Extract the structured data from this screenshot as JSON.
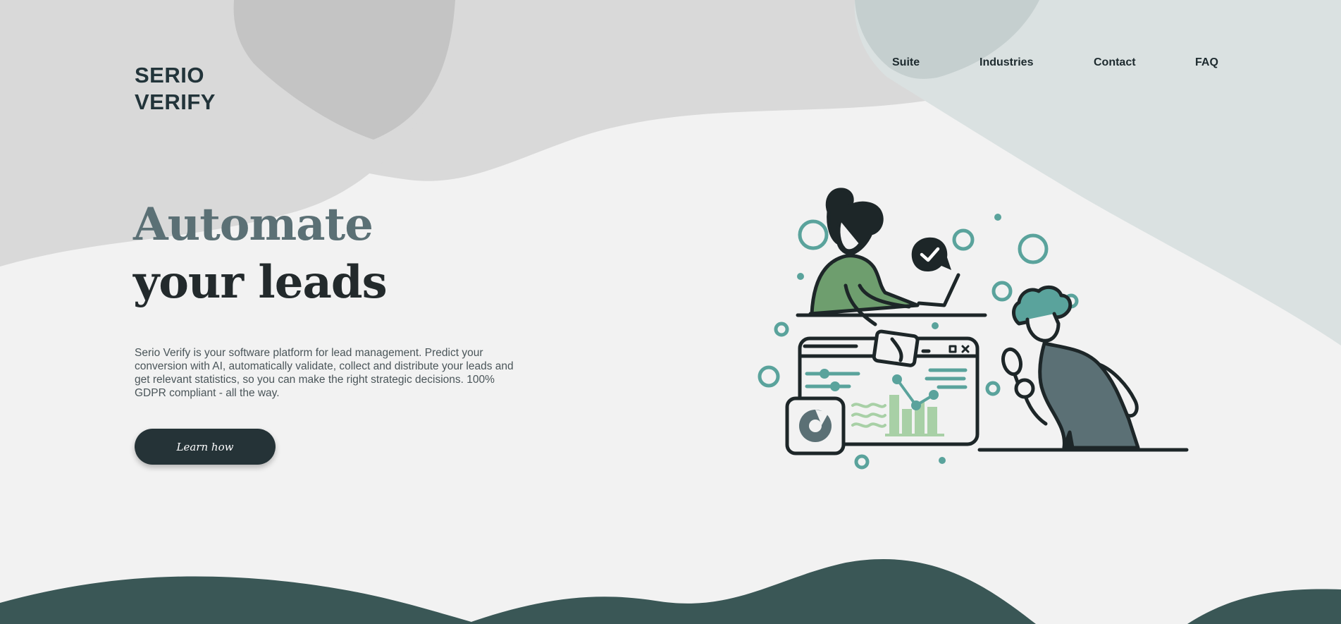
{
  "brand": {
    "line1": "SERIO",
    "line2": "VERIFY"
  },
  "nav": {
    "items": [
      "Suite",
      "Industries",
      "Contact",
      "FAQ"
    ]
  },
  "hero": {
    "title_line1": "Automate",
    "title_line2": "your leads",
    "description": "Serio Verify is your software platform for lead management. Predict your conversion with AI, automatically validate, collect and distribute your leads and get relevant statistics, so you can make the right strategic decisions. 100% GDPR compliant - all the way.",
    "cta_label": "Learn how"
  },
  "colors": {
    "background": "#f2f2f2",
    "dark": "#253337",
    "title_accent": "#5b7075",
    "teal": "#5aa39c",
    "green": "#6e9e6e",
    "wave": "#3a5756"
  },
  "icons": {
    "check": "check-icon",
    "illustration": "lead-management-illustration"
  }
}
